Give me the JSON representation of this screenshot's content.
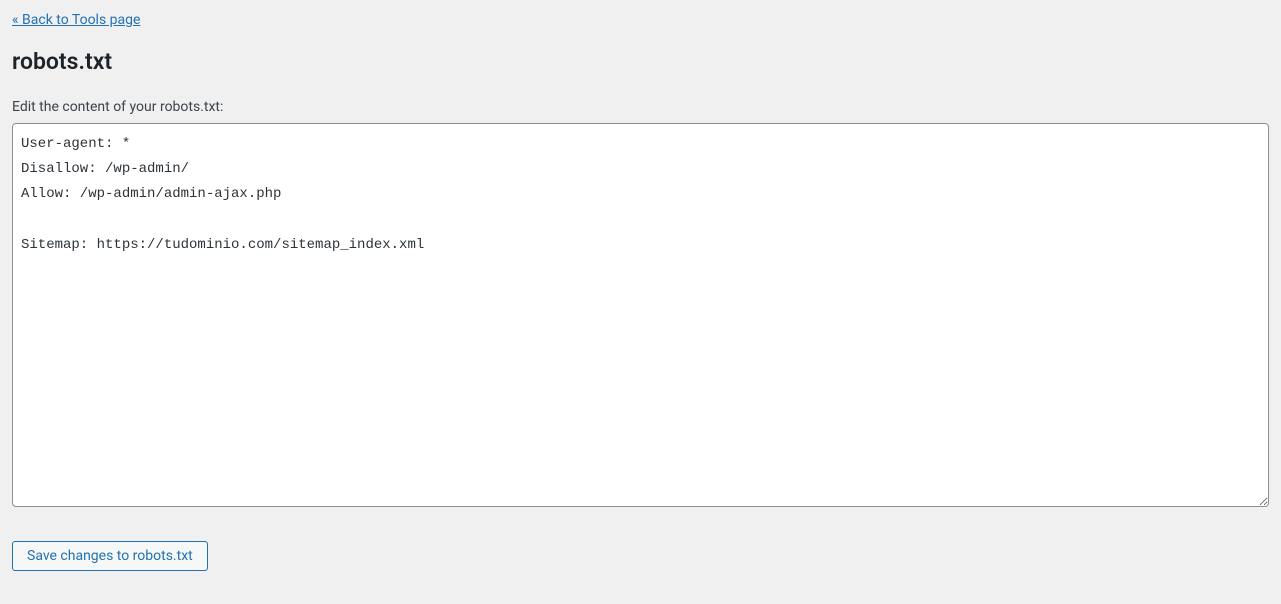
{
  "nav": {
    "back_link_text": "« Back to Tools page"
  },
  "page": {
    "title": "robots.txt",
    "field_label": "Edit the content of your robots.txt:"
  },
  "editor": {
    "content": "User-agent: *\nDisallow: /wp-admin/\nAllow: /wp-admin/admin-ajax.php\n\nSitemap: https://tudominio.com/sitemap_index.xml"
  },
  "actions": {
    "save_button_label": "Save changes to robots.txt"
  }
}
